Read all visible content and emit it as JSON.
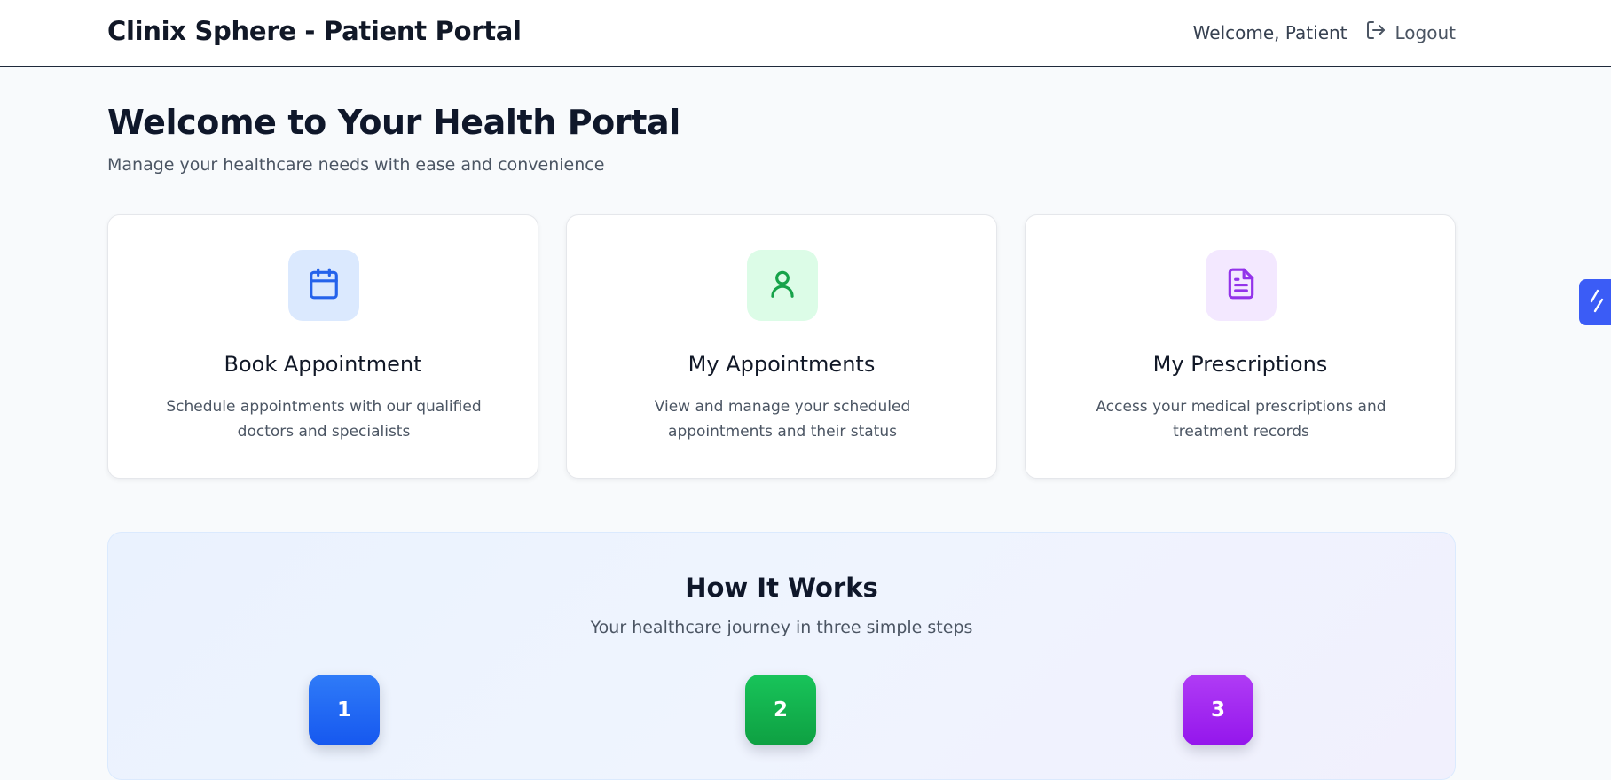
{
  "header": {
    "title": "Clinix Sphere - Patient Portal",
    "welcome": "Welcome, Patient",
    "logout_label": "Logout",
    "logout_icon": "logout-icon"
  },
  "main": {
    "title": "Welcome to Your Health Portal",
    "subtitle": "Manage your healthcare needs with ease and convenience"
  },
  "cards": [
    {
      "title": "Book Appointment",
      "description": "Schedule appointments with our qualified doctors and specialists",
      "icon": "calendar-icon",
      "icon_bg": "#dbe9fe",
      "icon_color": "#2563eb"
    },
    {
      "title": "My Appointments",
      "description": "View and manage your scheduled appointments and their status",
      "icon": "user-icon",
      "icon_bg": "#dcfce7",
      "icon_color": "#16a34a"
    },
    {
      "title": "My Prescriptions",
      "description": "Access your medical prescriptions and treatment records",
      "icon": "document-icon",
      "icon_bg": "#f3e8ff",
      "icon_color": "#9333ea"
    }
  ],
  "how_it_works": {
    "title": "How It Works",
    "subtitle": "Your healthcare journey in three simple steps",
    "steps": [
      {
        "number": "1",
        "color": "#1d6cf5"
      },
      {
        "number": "2",
        "color": "#12b04c"
      },
      {
        "number": "3",
        "color": "#a121f0"
      }
    ]
  },
  "side_widget": {
    "icon": "lightning-icon",
    "color": "#3b5cf6"
  }
}
